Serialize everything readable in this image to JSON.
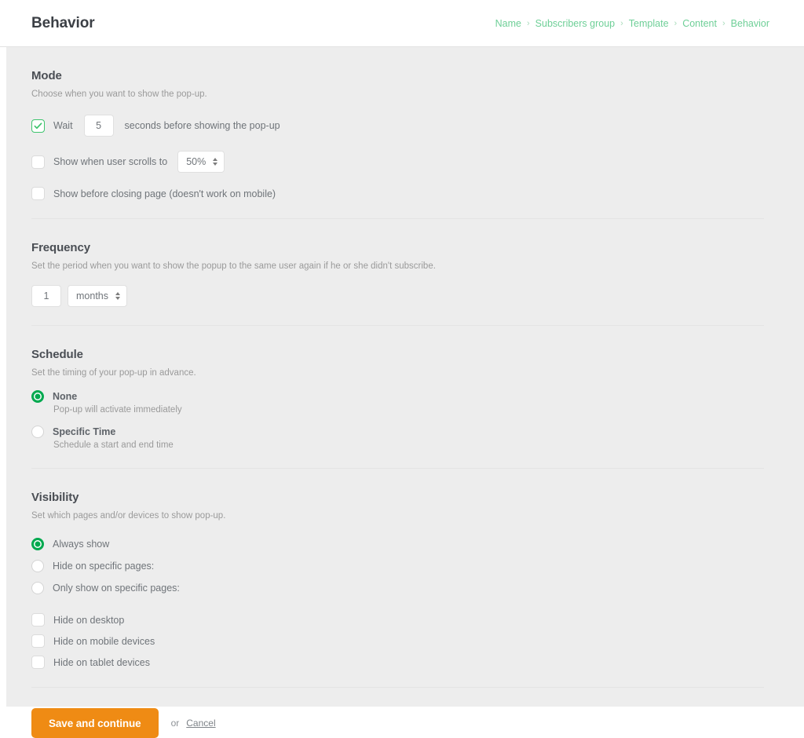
{
  "header": {
    "title": "Behavior",
    "breadcrumb": [
      {
        "label": "Name"
      },
      {
        "label": "Subscribers group"
      },
      {
        "label": "Template"
      },
      {
        "label": "Content"
      },
      {
        "label": "Behavior"
      }
    ],
    "separator": "›"
  },
  "colors": {
    "accent_green": "#00a94f",
    "checkbox_green": "#3ec46d",
    "breadcrumb_green": "#6ecf97",
    "primary_button_orange": "#ef8b14",
    "page_background": "#ededed",
    "header_background": "#ffffff"
  },
  "mode": {
    "title": "Mode",
    "description": "Choose when you want to show the pop-up.",
    "wait": {
      "checked": true,
      "label": "Wait",
      "value": "5",
      "suffix": "seconds before showing the pop-up"
    },
    "scroll": {
      "checked": false,
      "label": "Show when user scrolls to",
      "value": "50%"
    },
    "exit_intent": {
      "checked": false,
      "label": "Show before closing page (doesn't work on mobile)"
    }
  },
  "frequency": {
    "title": "Frequency",
    "description": "Set the period when you want to show the popup to the same user again if he or she didn't subscribe.",
    "amount": "1",
    "unit": "months"
  },
  "schedule": {
    "title": "Schedule",
    "description": "Set the timing of your pop-up in advance.",
    "options": [
      {
        "label": "None",
        "sub": "Pop-up will activate immediately",
        "selected": true
      },
      {
        "label": "Specific Time",
        "sub": "Schedule a start and end time",
        "selected": false
      }
    ]
  },
  "visibility": {
    "title": "Visibility",
    "description": "Set which pages and/or devices to show pop-up.",
    "page_options": [
      {
        "label": "Always show",
        "selected": true
      },
      {
        "label": "Hide on specific pages:",
        "selected": false
      },
      {
        "label": "Only show on specific pages:",
        "selected": false
      }
    ],
    "device_options": [
      {
        "label": "Hide on desktop",
        "checked": false
      },
      {
        "label": "Hide on mobile devices",
        "checked": false
      },
      {
        "label": "Hide on tablet devices",
        "checked": false
      }
    ]
  },
  "footer": {
    "save_label": "Save and continue",
    "or_label": "or",
    "cancel_label": "Cancel"
  }
}
